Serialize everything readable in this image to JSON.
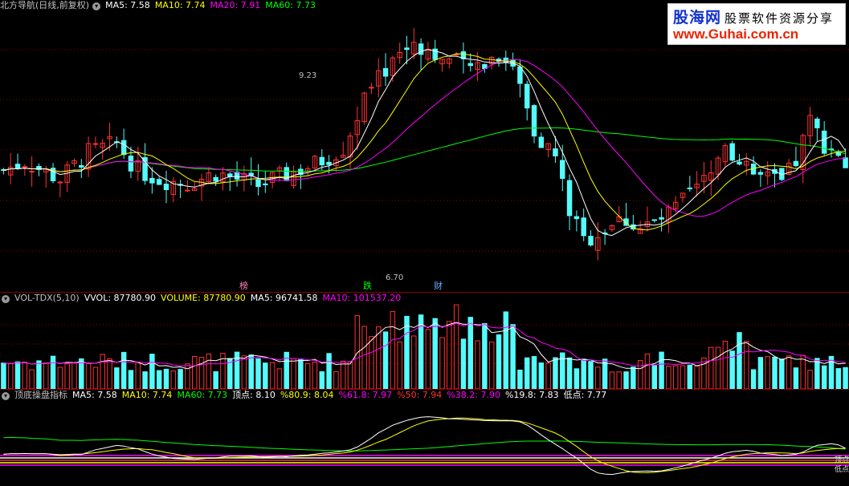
{
  "price_header": {
    "title": "北方导航(日线,前复权)",
    "ma5": "MA5: 7.58",
    "ma10": "MA10: 7.74",
    "ma20": "MA20: 7.91",
    "ma60": "MA60: 7.73"
  },
  "price_annotations": {
    "high_label": "9.23",
    "low_label": "6.70",
    "marker_1": "榜",
    "marker_2": "跌",
    "marker_3": "财"
  },
  "vol_header": {
    "title": "VOL-TDX(5,10)",
    "vvol": "VVOL: 87780.90",
    "volume": "VOLUME: 87780.90",
    "ma5": "MA5: 96741.58",
    "ma10": "MA10: 101537.20"
  },
  "ind_header": {
    "title": "顶底操盘指标",
    "ma5": "MA5: 7.58",
    "ma10": "MA10: 7.74",
    "ma60": "MA60: 7.73",
    "top": "顶点: 8.10",
    "p809": "%80.9: 8.04",
    "p618": "%61.8: 7.97",
    "p50": "%50: 7.94",
    "p382": "%38.2: 7.90",
    "p198": "%19.8: 7.83",
    "low": "低点: 7.77"
  },
  "right_tags": {
    "tag_top": "顶点",
    "tag_low": "低点"
  },
  "logo": {
    "name": "股海网",
    "slogan": "股票软件资源分享",
    "url": "www.Guhai.com.cn"
  },
  "colors": {
    "up": "#ff3232",
    "down": "#54fcfc",
    "ma5": "#ffffff",
    "ma10": "#ffff00",
    "ma20": "#ff00ff",
    "ma60": "#00ff00",
    "bg": "#000000",
    "grid": "#8b0000"
  },
  "chart_data": {
    "type": "candlestick",
    "price_range": [
      6.5,
      9.4
    ],
    "volume_range": [
      0,
      200000
    ],
    "bar_count": 120,
    "series": [
      {
        "name": "MA5"
      },
      {
        "name": "MA10"
      },
      {
        "name": "MA20"
      },
      {
        "name": "MA60"
      }
    ]
  }
}
